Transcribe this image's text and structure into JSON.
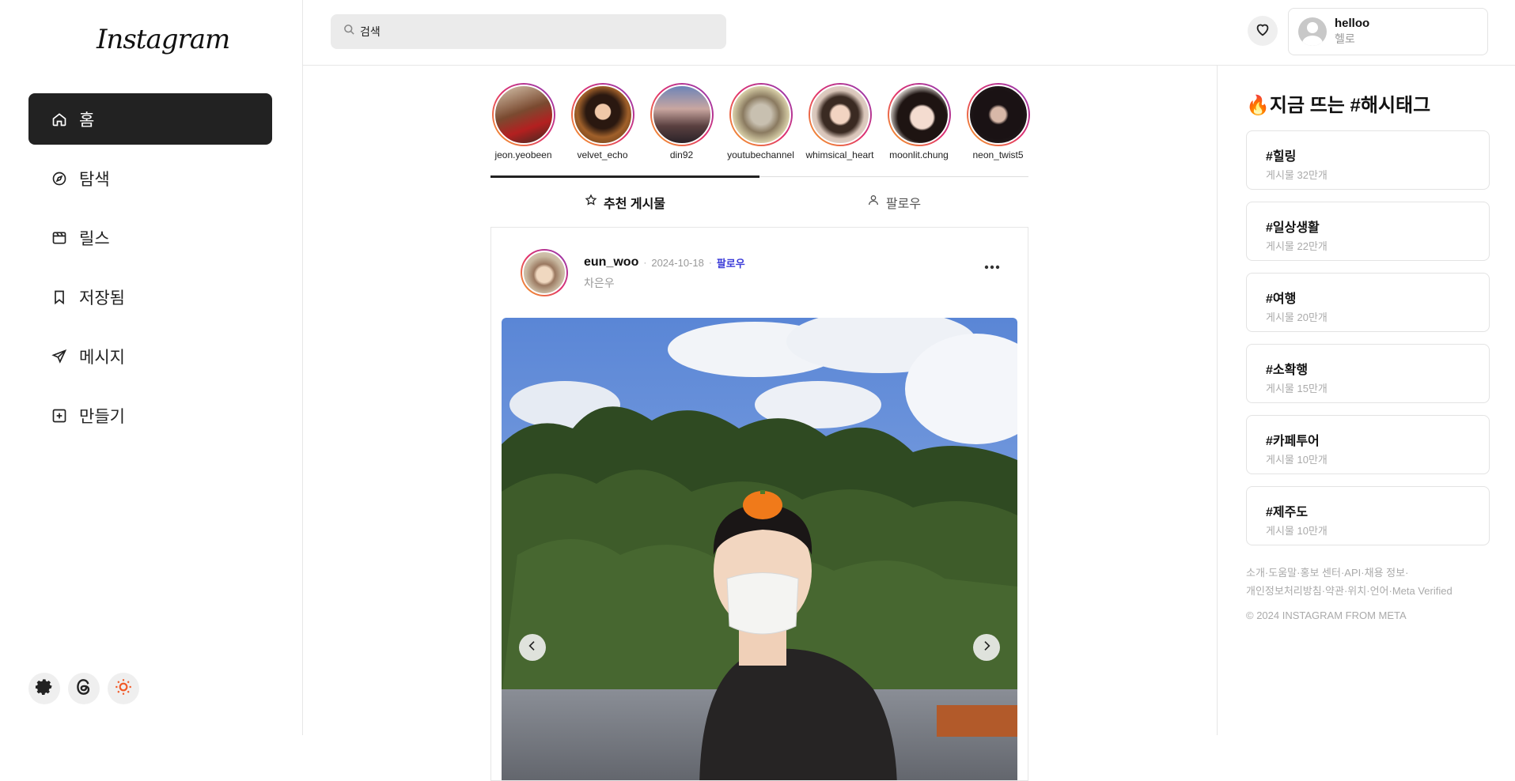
{
  "app": {
    "logo_text": "Instagram"
  },
  "nav": {
    "items": [
      {
        "label": "홈",
        "icon": "home-icon"
      },
      {
        "label": "탐색",
        "icon": "compass-icon"
      },
      {
        "label": "릴스",
        "icon": "reels-icon"
      },
      {
        "label": "저장됨",
        "icon": "bookmark-icon"
      },
      {
        "label": "메시지",
        "icon": "send-icon"
      },
      {
        "label": "만들기",
        "icon": "plus-square-icon"
      }
    ],
    "active": "홈",
    "bottom": [
      "gear-icon",
      "threads-icon",
      "sun-icon"
    ]
  },
  "search": {
    "placeholder": "검색",
    "value": ""
  },
  "profile": {
    "name": "helloo",
    "subname": "헬로"
  },
  "stories": [
    {
      "name": "jeon.yeobeen"
    },
    {
      "name": "velvet_echo"
    },
    {
      "name": "din92"
    },
    {
      "name": "youtubechannel"
    },
    {
      "name": "whimsical_heart"
    },
    {
      "name": "moonlit.chung"
    },
    {
      "name": "neon_twist5"
    }
  ],
  "tabs": [
    {
      "label": "추천 게시물",
      "icon": "star-icon"
    },
    {
      "label": "팔로우",
      "icon": "user-icon"
    }
  ],
  "post": {
    "username": "eun_woo",
    "date": "2024-10-18",
    "follow_label": "팔로우",
    "subname": "차은우"
  },
  "trending": {
    "title": "🔥지금 뜨는 #해시태그",
    "tags": [
      {
        "tag": "#힐링",
        "count": "게시물 32만개"
      },
      {
        "tag": "#일상생활",
        "count": "게시물 22만개"
      },
      {
        "tag": "#여행",
        "count": "게시물 20만개"
      },
      {
        "tag": "#소확행",
        "count": "게시물 15만개"
      },
      {
        "tag": "#카페투어",
        "count": "게시물 10만개"
      },
      {
        "tag": "#제주도",
        "count": "게시물 10만개"
      }
    ]
  },
  "footer": {
    "links": [
      "소개",
      "도움말",
      "홍보 센터",
      "API",
      "채용 정보",
      "개인정보처리방침",
      "약관",
      "위치",
      "언어",
      "Meta Verified"
    ],
    "copyright": "© 2024 INSTAGRAM FROM META"
  },
  "colors": {
    "accent": "#3b3bd8",
    "active_nav_bg": "#222222"
  }
}
